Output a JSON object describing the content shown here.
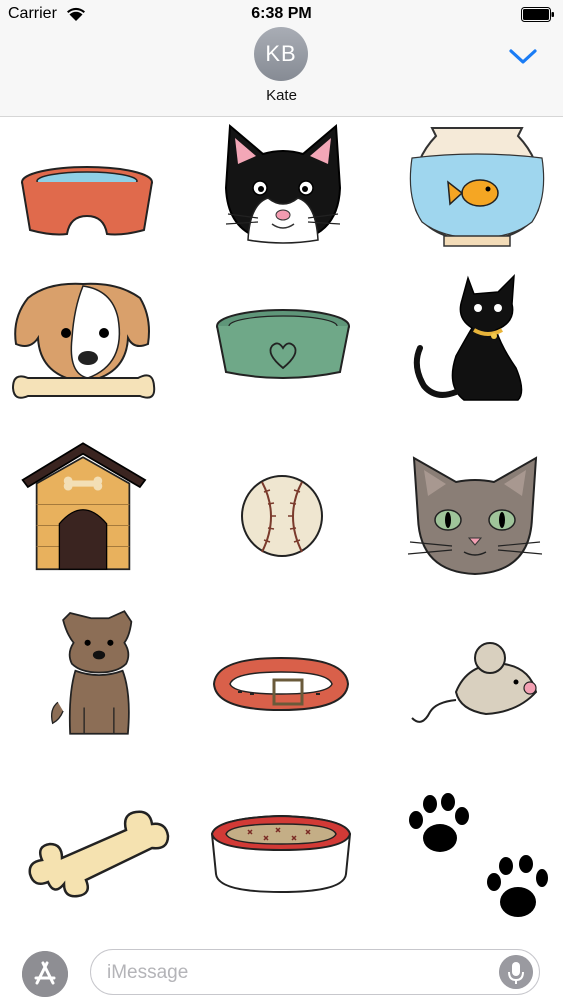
{
  "status_bar": {
    "carrier": "Carrier",
    "time": "6:38 PM"
  },
  "header": {
    "avatar_initials": "KB",
    "contact_name": "Kate",
    "accent_color": "#1a7cf5"
  },
  "stickers": [
    {
      "icon": "orange-food-bowl-icon"
    },
    {
      "icon": "black-white-cat-face-icon"
    },
    {
      "icon": "goldfish-bowl-icon"
    },
    {
      "icon": "puppy-with-bone-icon"
    },
    {
      "icon": "green-heart-bowl-icon"
    },
    {
      "icon": "black-cat-icon"
    },
    {
      "icon": "dog-house-icon"
    },
    {
      "icon": "baseball-icon"
    },
    {
      "icon": "gray-cat-face-icon"
    },
    {
      "icon": "brown-dog-sitting-icon"
    },
    {
      "icon": "red-collar-icon"
    },
    {
      "icon": "toy-mouse-icon"
    },
    {
      "icon": "bone-icon"
    },
    {
      "icon": "pet-bed-icon"
    },
    {
      "icon": "paw-prints-icon"
    }
  ],
  "composer": {
    "placeholder": "iMessage"
  }
}
